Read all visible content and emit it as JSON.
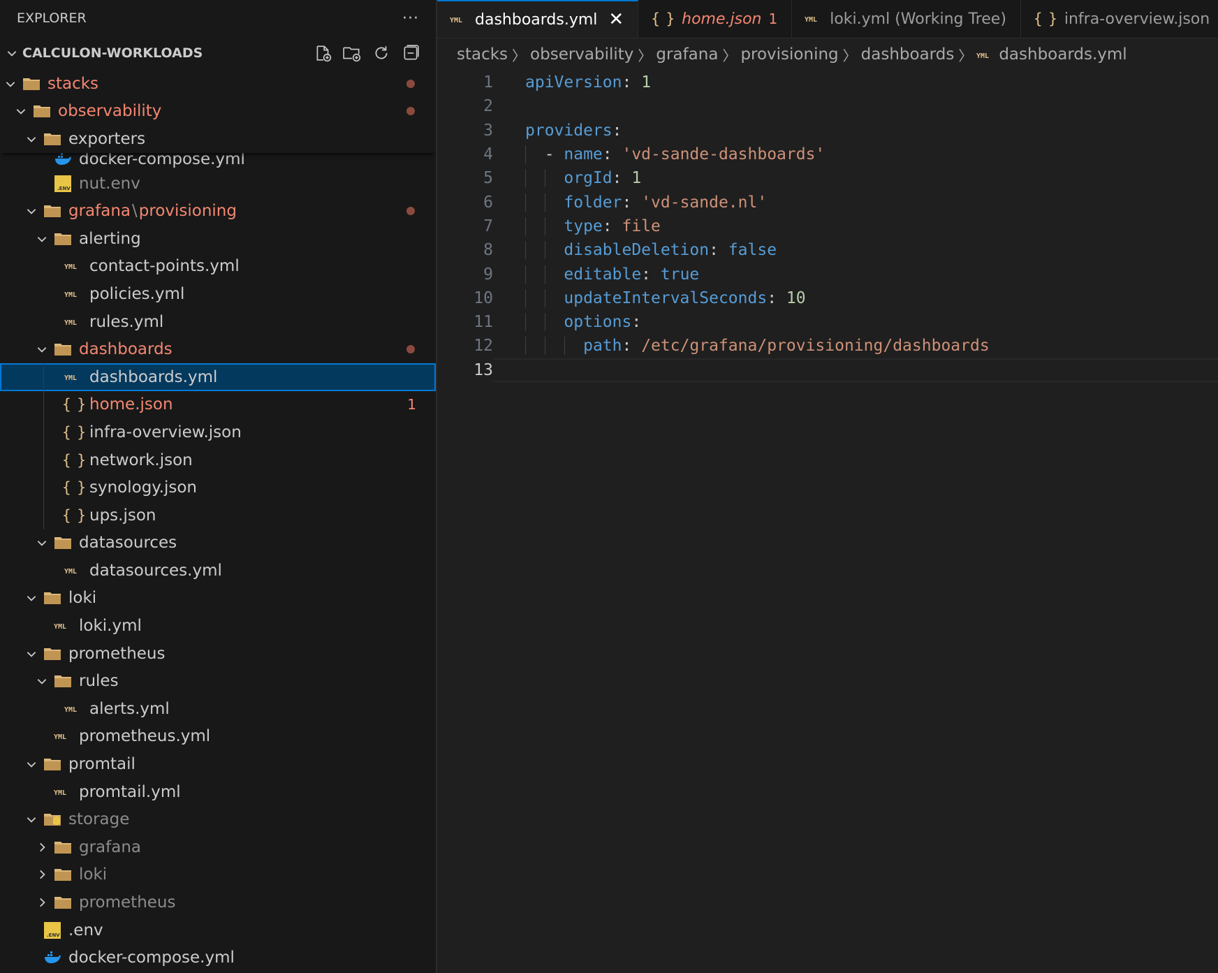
{
  "sidebar": {
    "title": "EXPLORER",
    "more": "···",
    "workspace": "CALCULON-WORKLOADS",
    "actions": [
      "new-file-icon",
      "new-folder-icon",
      "refresh-icon",
      "collapse-all-icon"
    ],
    "items": [
      {
        "label": "stacks",
        "status": "modified-dot"
      },
      {
        "label": "observability",
        "status": "modified-dot"
      },
      {
        "label": "exporters"
      },
      {
        "label": "docker-compose.yml"
      },
      {
        "label": "nut.env"
      },
      {
        "label_a": "grafana",
        "label_sep": "\\",
        "label_b": "provisioning",
        "status": "modified-dot"
      },
      {
        "label": "alerting"
      },
      {
        "label": "contact-points.yml"
      },
      {
        "label": "policies.yml"
      },
      {
        "label": "rules.yml"
      },
      {
        "label": "dashboards",
        "status": "modified-dot"
      },
      {
        "label": "dashboards.yml"
      },
      {
        "label": "home.json",
        "count": "1"
      },
      {
        "label": "infra-overview.json"
      },
      {
        "label": "network.json"
      },
      {
        "label": "synology.json"
      },
      {
        "label": "ups.json"
      },
      {
        "label": "datasources"
      },
      {
        "label": "datasources.yml"
      },
      {
        "label": "loki"
      },
      {
        "label": "loki.yml"
      },
      {
        "label": "prometheus"
      },
      {
        "label": "rules"
      },
      {
        "label": "alerts.yml"
      },
      {
        "label": "prometheus.yml"
      },
      {
        "label": "promtail"
      },
      {
        "label": "promtail.yml"
      },
      {
        "label": "storage"
      },
      {
        "label": "grafana"
      },
      {
        "label": "loki"
      },
      {
        "label": "prometheus"
      },
      {
        "label": ".env"
      },
      {
        "label": "docker-compose.yml"
      }
    ]
  },
  "tabs": [
    {
      "label": "dashboards.yml",
      "close": "✕"
    },
    {
      "label": "home.json",
      "count": "1"
    },
    {
      "label": "loki.yml (Working Tree)"
    },
    {
      "label": "infra-overview.json"
    }
  ],
  "breadcrumb": [
    "stacks",
    "observability",
    "grafana",
    "provisioning",
    "dashboards",
    "dashboards.yml"
  ],
  "code": {
    "line_numbers": [
      "1",
      "2",
      "3",
      "4",
      "5",
      "6",
      "7",
      "8",
      "9",
      "10",
      "11",
      "12",
      "13"
    ],
    "current_line": "13",
    "lines": [
      [
        {
          "t": "apiVersion",
          "c": "k"
        },
        {
          "t": ": ",
          "c": "p"
        },
        {
          "t": "1",
          "c": "n"
        }
      ],
      [],
      [
        {
          "t": "providers",
          "c": "k"
        },
        {
          "t": ":",
          "c": "p"
        }
      ],
      [
        {
          "t": "  - ",
          "c": "p"
        },
        {
          "t": "name",
          "c": "k"
        },
        {
          "t": ": ",
          "c": "p"
        },
        {
          "t": "'vd-sande-dashboards'",
          "c": "s"
        }
      ],
      [
        {
          "t": "    ",
          "c": "p"
        },
        {
          "t": "orgId",
          "c": "k"
        },
        {
          "t": ": ",
          "c": "p"
        },
        {
          "t": "1",
          "c": "n"
        }
      ],
      [
        {
          "t": "    ",
          "c": "p"
        },
        {
          "t": "folder",
          "c": "k"
        },
        {
          "t": ": ",
          "c": "p"
        },
        {
          "t": "'vd-sande.nl'",
          "c": "s"
        }
      ],
      [
        {
          "t": "    ",
          "c": "p"
        },
        {
          "t": "type",
          "c": "k"
        },
        {
          "t": ": ",
          "c": "p"
        },
        {
          "t": "file",
          "c": "s"
        }
      ],
      [
        {
          "t": "    ",
          "c": "p"
        },
        {
          "t": "disableDeletion",
          "c": "k"
        },
        {
          "t": ": ",
          "c": "p"
        },
        {
          "t": "false",
          "c": "b"
        }
      ],
      [
        {
          "t": "    ",
          "c": "p"
        },
        {
          "t": "editable",
          "c": "k"
        },
        {
          "t": ": ",
          "c": "p"
        },
        {
          "t": "true",
          "c": "b"
        }
      ],
      [
        {
          "t": "    ",
          "c": "p"
        },
        {
          "t": "updateIntervalSeconds",
          "c": "k"
        },
        {
          "t": ": ",
          "c": "p"
        },
        {
          "t": "10",
          "c": "n"
        }
      ],
      [
        {
          "t": "    ",
          "c": "p"
        },
        {
          "t": "options",
          "c": "k"
        },
        {
          "t": ":",
          "c": "p"
        }
      ],
      [
        {
          "t": "      ",
          "c": "p"
        },
        {
          "t": "path",
          "c": "k"
        },
        {
          "t": ": ",
          "c": "p"
        },
        {
          "t": "/etc/grafana/provisioning/dashboards",
          "c": "s"
        }
      ],
      []
    ]
  },
  "colors": {
    "accent": "#0078d4",
    "modified": "#f48771",
    "key": "#569cd6",
    "string": "#ce9178",
    "number": "#b5cea8"
  }
}
